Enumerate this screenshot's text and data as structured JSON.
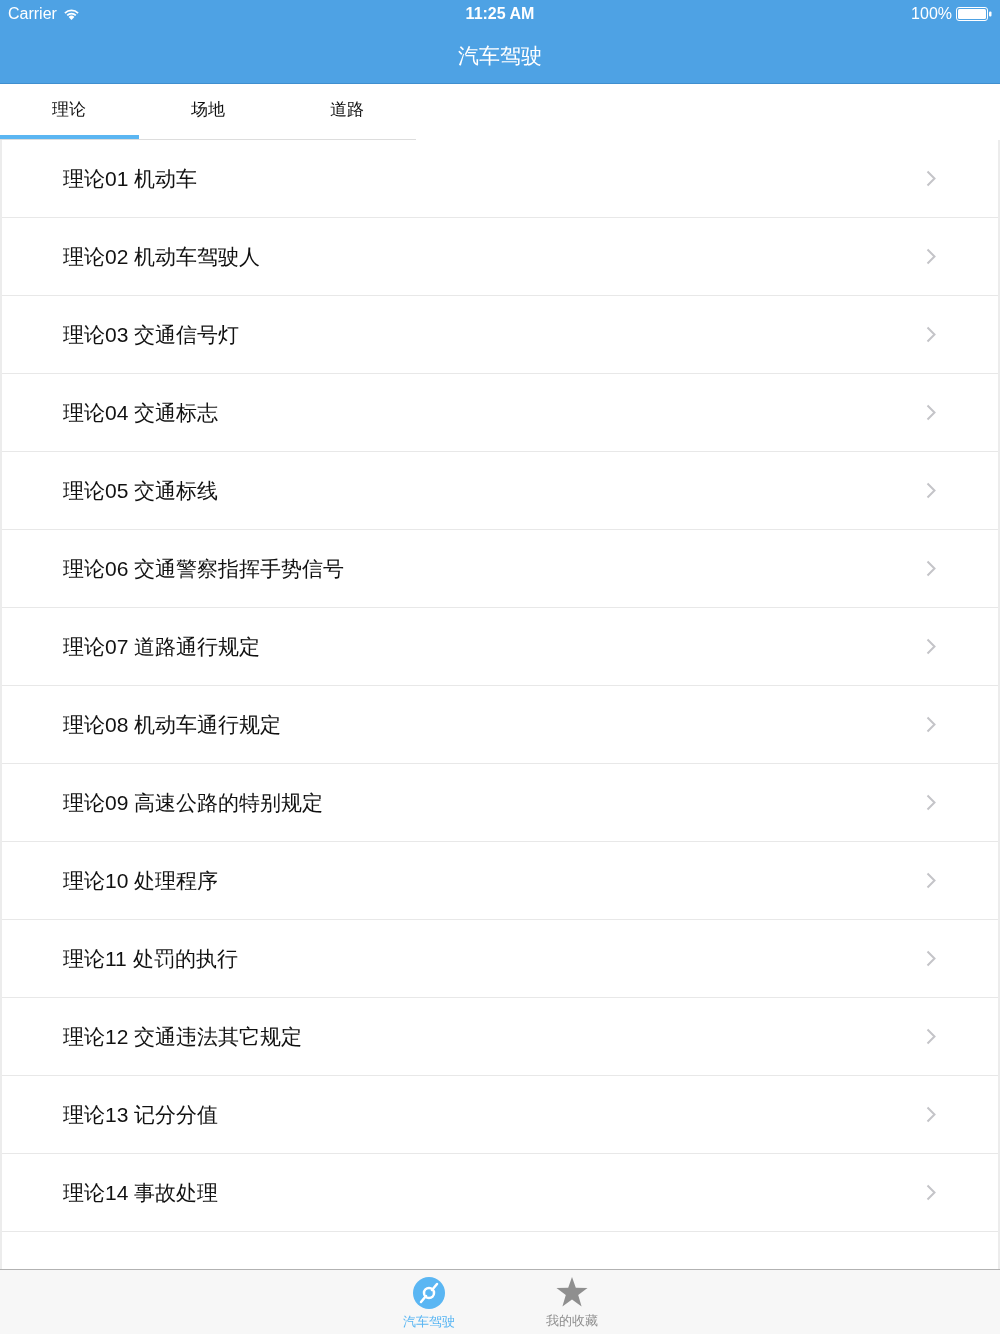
{
  "status_bar": {
    "carrier": "Carrier",
    "time": "11:25 AM",
    "battery": "100%"
  },
  "nav_bar": {
    "title": "汽车驾驶"
  },
  "tabs": [
    {
      "label": "理论",
      "selected": true
    },
    {
      "label": "场地",
      "selected": false
    },
    {
      "label": "道路",
      "selected": false
    }
  ],
  "list": {
    "items": [
      {
        "label": "理论01 机动车"
      },
      {
        "label": "理论02 机动车驾驶人"
      },
      {
        "label": "理论03 交通信号灯"
      },
      {
        "label": "理论04 交通标志"
      },
      {
        "label": "理论05 交通标线"
      },
      {
        "label": "理论06 交通警察指挥手势信号"
      },
      {
        "label": "理论07 道路通行规定"
      },
      {
        "label": "理论08 机动车通行规定"
      },
      {
        "label": "理论09 高速公路的特别规定"
      },
      {
        "label": "理论10 处理程序"
      },
      {
        "label": "理论11 处罚的执行"
      },
      {
        "label": "理论12 交通违法其它规定"
      },
      {
        "label": "理论13 记分分值"
      },
      {
        "label": "理论14 事故处理"
      }
    ]
  },
  "tab_bar": {
    "items": [
      {
        "label": "汽车驾驶",
        "selected": true,
        "kind": "disc"
      },
      {
        "label": "我的收藏",
        "selected": false,
        "kind": "star"
      }
    ]
  }
}
